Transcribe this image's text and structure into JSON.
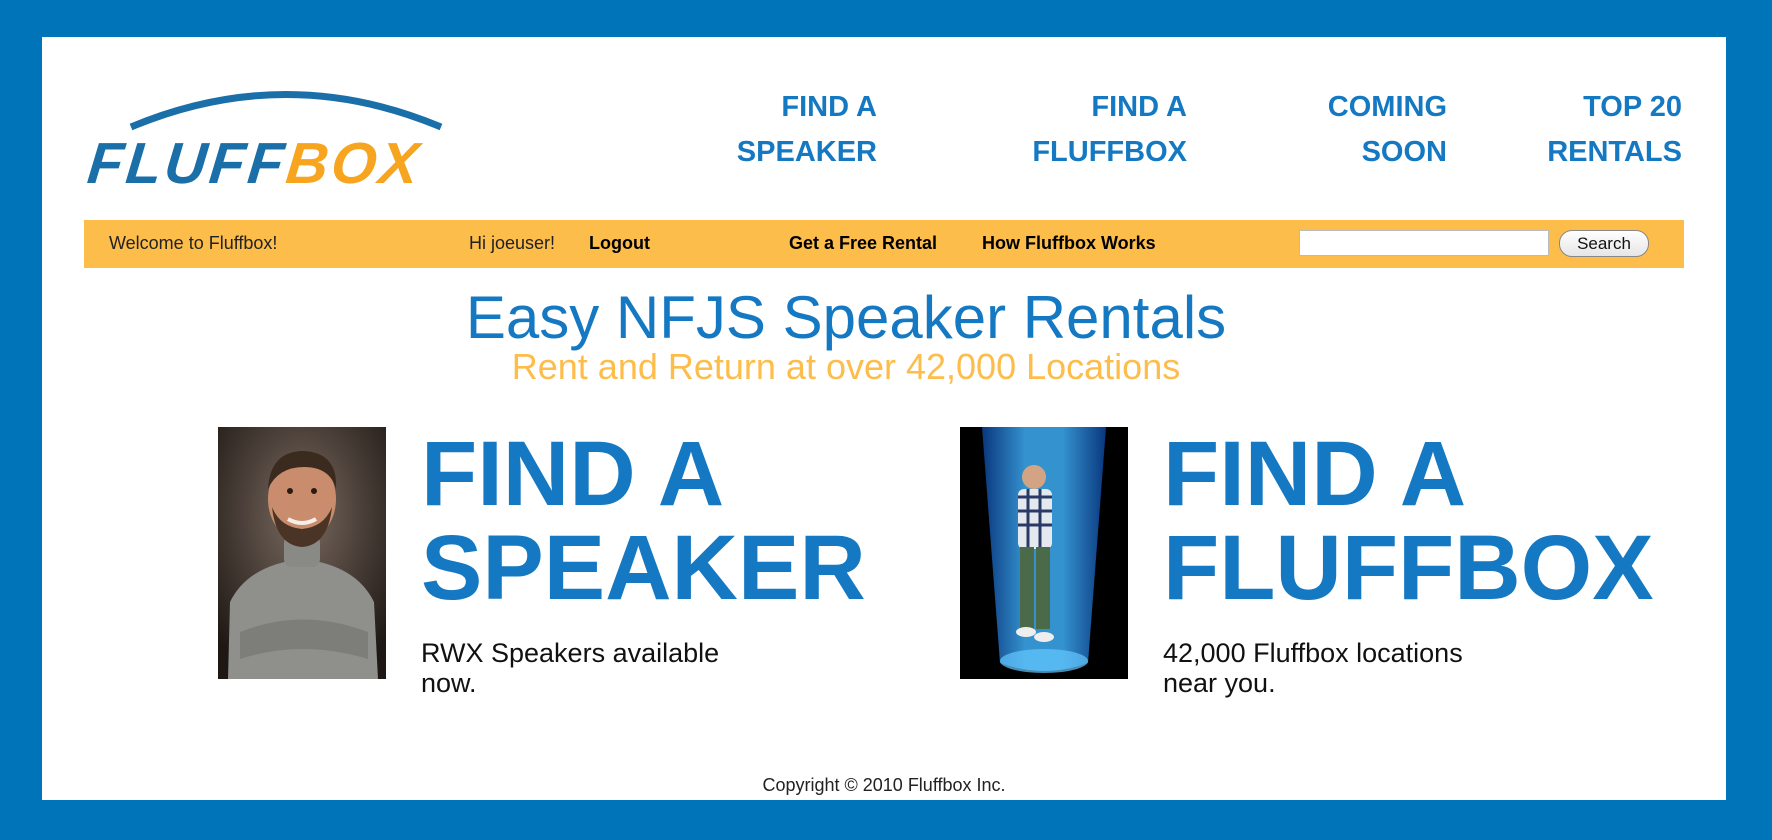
{
  "brand": {
    "logo_part1": "FLUFF",
    "logo_part2": "BOX",
    "colors": {
      "frame_blue": "#0074b8",
      "link_blue": "#1479c2",
      "accent_yellow": "#fdbd4a",
      "logo_blue": "#1a6fa8",
      "logo_orange": "#f7a51f"
    }
  },
  "topnav": [
    {
      "line1": "FIND A",
      "line2": "SPEAKER"
    },
    {
      "line1": "FIND A",
      "line2": "FLUFFBOX"
    },
    {
      "line1": "COMING",
      "line2": "SOON"
    },
    {
      "line1": "TOP 20",
      "line2": "RENTALS"
    }
  ],
  "bar": {
    "welcome": "Welcome to Fluffbox!",
    "greeting": "Hi joeuser!",
    "logout": "Logout",
    "free_rental": "Get a Free Rental",
    "how_it_works": "How Fluffbox Works",
    "search_value": "",
    "search_button": "Search"
  },
  "headline": "Easy NFJS Speaker Rentals",
  "subheadline": "Rent and Return at over 42,000 Locations",
  "promos": [
    {
      "title_line1": "FIND A",
      "title_line2": "SPEAKER",
      "description": "RWX Speakers available now.",
      "image": "speaker-portrait-photo"
    },
    {
      "title_line1": "FIND A",
      "title_line2": "FLUFFBOX",
      "description": "42,000 Fluffbox locations near you.",
      "image": "fluffbox-tube-photo"
    }
  ],
  "footer": "Copyright © 2010 Fluffbox Inc."
}
